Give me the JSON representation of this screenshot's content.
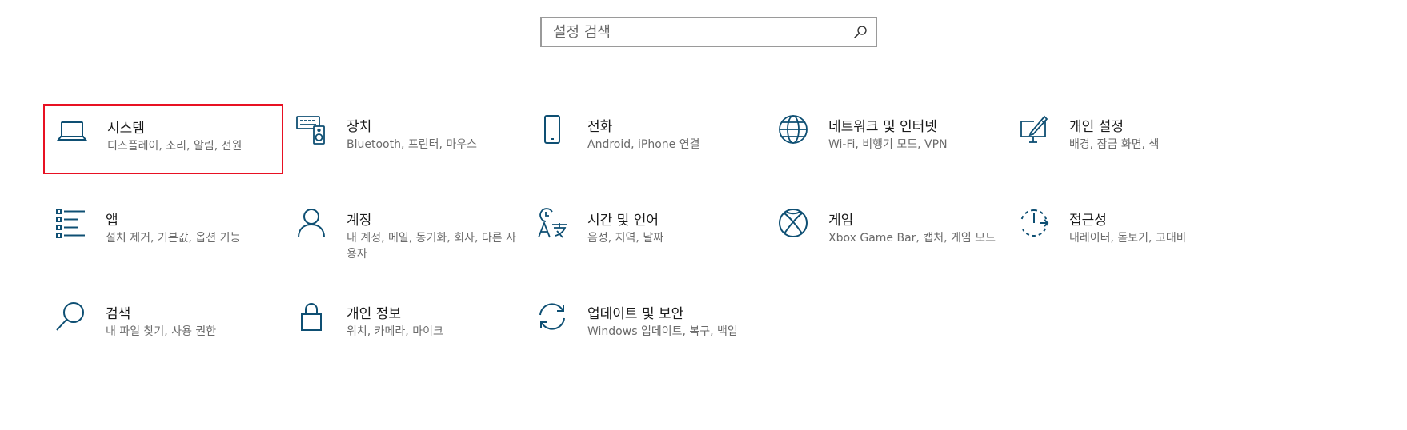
{
  "search": {
    "placeholder": "설정 검색"
  },
  "accent_color": "#0e4f73",
  "selection_color": "#e81123",
  "tiles": [
    {
      "title": "시스템",
      "desc": "디스플레이, 소리, 알림, 전원",
      "icon": "laptop-icon"
    },
    {
      "title": "장치",
      "desc": "Bluetooth, 프린터, 마우스",
      "icon": "devices-icon"
    },
    {
      "title": "전화",
      "desc": "Android, iPhone 연결",
      "icon": "phone-icon"
    },
    {
      "title": "네트워크 및 인터넷",
      "desc": "Wi-Fi, 비행기 모드, VPN",
      "icon": "globe-icon"
    },
    {
      "title": "개인 설정",
      "desc": "배경, 잠금 화면, 색",
      "icon": "personalization-icon"
    },
    {
      "title": "앱",
      "desc": "설치 제거, 기본값, 옵션 기능",
      "icon": "apps-list-icon"
    },
    {
      "title": "계정",
      "desc": "내 계정, 메일, 동기화, 회사, 다른 사용자",
      "icon": "person-icon"
    },
    {
      "title": "시간 및 언어",
      "desc": "음성, 지역, 날짜",
      "icon": "time-language-icon"
    },
    {
      "title": "게임",
      "desc": "Xbox Game Bar, 캡처, 게임 모드",
      "icon": "xbox-icon"
    },
    {
      "title": "접근성",
      "desc": "내레이터, 돋보기, 고대비",
      "icon": "accessibility-icon"
    },
    {
      "title": "검색",
      "desc": "내 파일 찾기, 사용 권한",
      "icon": "search-magnifier-icon"
    },
    {
      "title": "개인 정보",
      "desc": "위치, 카메라, 마이크",
      "icon": "lock-icon"
    },
    {
      "title": "업데이트 및 보안",
      "desc": "Windows 업데이트, 복구, 백업",
      "icon": "sync-icon"
    }
  ]
}
